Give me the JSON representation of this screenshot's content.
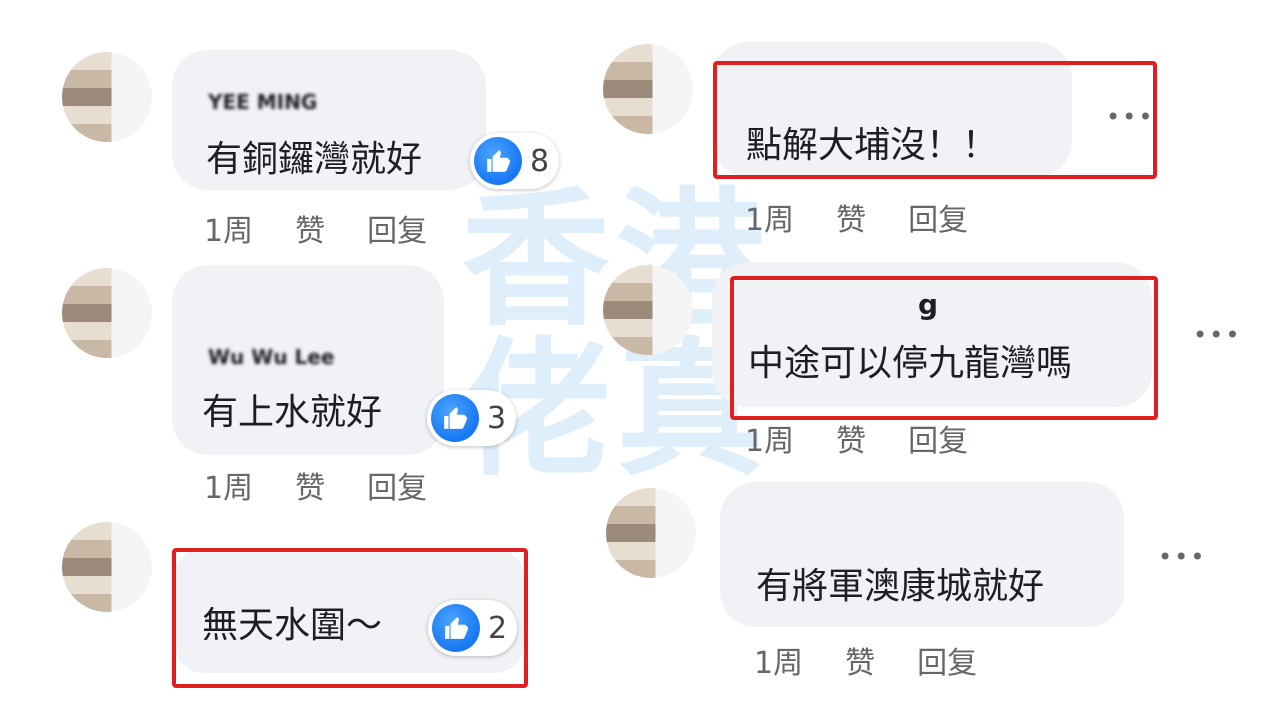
{
  "watermark": "香港佬真",
  "comments": [
    {
      "name": "YEE MING",
      "text": "有銅鑼灣就好",
      "likes": "8",
      "time": "1周",
      "like_label": "赞",
      "reply_label": "回复"
    },
    {
      "name": "Wu Wu Lee",
      "text": "有上水就好",
      "likes": "3",
      "time": "1周",
      "like_label": "赞",
      "reply_label": "回复"
    },
    {
      "name": "",
      "text": "無天水圍～",
      "likes": "2"
    },
    {
      "text": "點解大埔沒！！",
      "time": "1周",
      "like_label": "赞",
      "reply_label": "回复",
      "more": "•••"
    },
    {
      "name": "g",
      "text": "中途可以停九龍灣嗎",
      "time": "1周",
      "like_label": "赞",
      "reply_label": "回复",
      "more": "•••"
    },
    {
      "text": "有將軍澳康城就好",
      "time": "1周",
      "like_label": "赞",
      "reply_label": "回复",
      "more": "•••"
    }
  ],
  "colors": {
    "highlight": "#e02020",
    "like_blue": "#1877f2",
    "bubble": "#f0f2f5"
  }
}
